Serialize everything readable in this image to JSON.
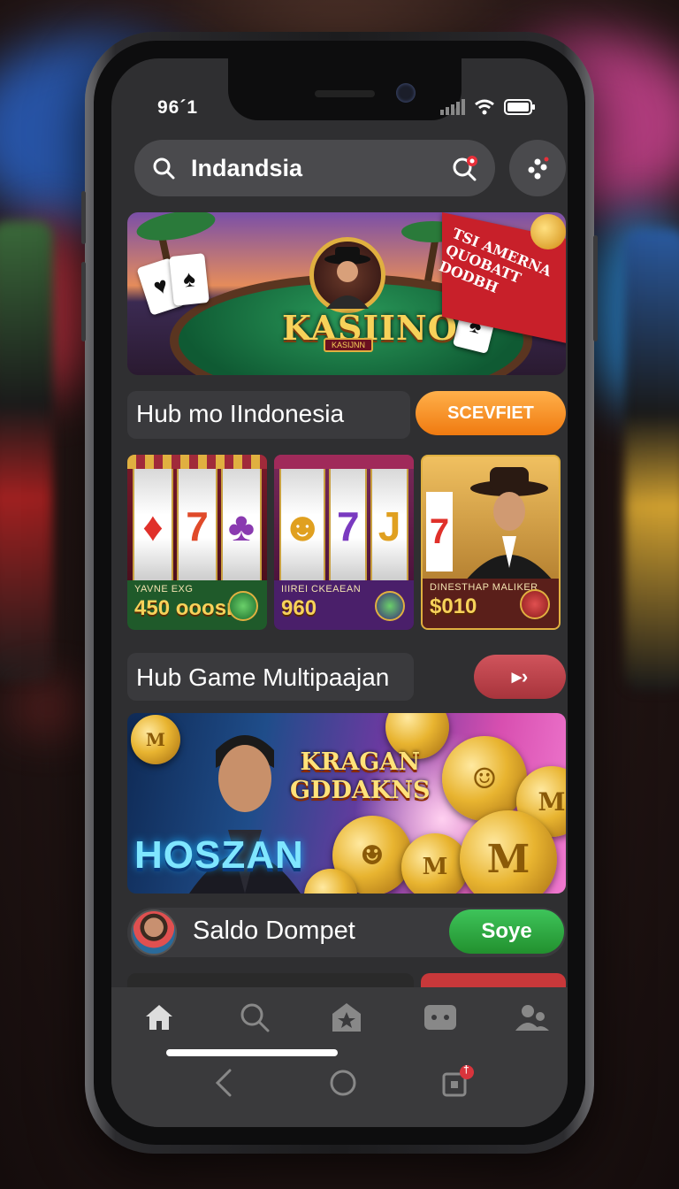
{
  "status_bar": {
    "time": "96´1"
  },
  "search": {
    "value": "Indandsia"
  },
  "banner": {
    "brand": "KASIINO",
    "brand_sub": "KASIJNN",
    "flag_text": "TSI AMERNA QUOBATT DODBH"
  },
  "section_indonesia": {
    "title": "Hub mo IIndonesia",
    "button_label": "SCEVFIET"
  },
  "slots": [
    {
      "name": "YAVNE EXG",
      "amount": "450 ooosn",
      "footer_color": "#1f5a2a",
      "badge_color": "#3aa04a"
    },
    {
      "name": "IIIREI CKEAEAN",
      "amount": "960",
      "footer_color": "#4a1f6a",
      "badge_color": "#3a9a4a"
    },
    {
      "name": "DINESTHAP MALIKER",
      "amount": "$010",
      "footer_color": "#5a1f1a",
      "badge_color": "#c03030"
    }
  ],
  "section_multiplayer": {
    "title": "Hub Game Multipaajan",
    "button_label": "▸›"
  },
  "promo": {
    "title_line1": "KRAGAN",
    "title_line2": "GDDAKNS",
    "name": "HOSZAN"
  },
  "wallet": {
    "label": "Saldo Dompet",
    "button_label": "Soye"
  },
  "bottom_nav": {
    "items": [
      "home-icon",
      "search-icon",
      "favorites-icon",
      "games-icon",
      "friends-icon"
    ],
    "active": "home-icon"
  },
  "system_nav": {
    "notification_badge": "†"
  },
  "colors": {
    "orange": "#f08a1e",
    "red_button": "#c0444c",
    "green_button": "#2ea44a",
    "screen_bg": "#2f2f31"
  }
}
